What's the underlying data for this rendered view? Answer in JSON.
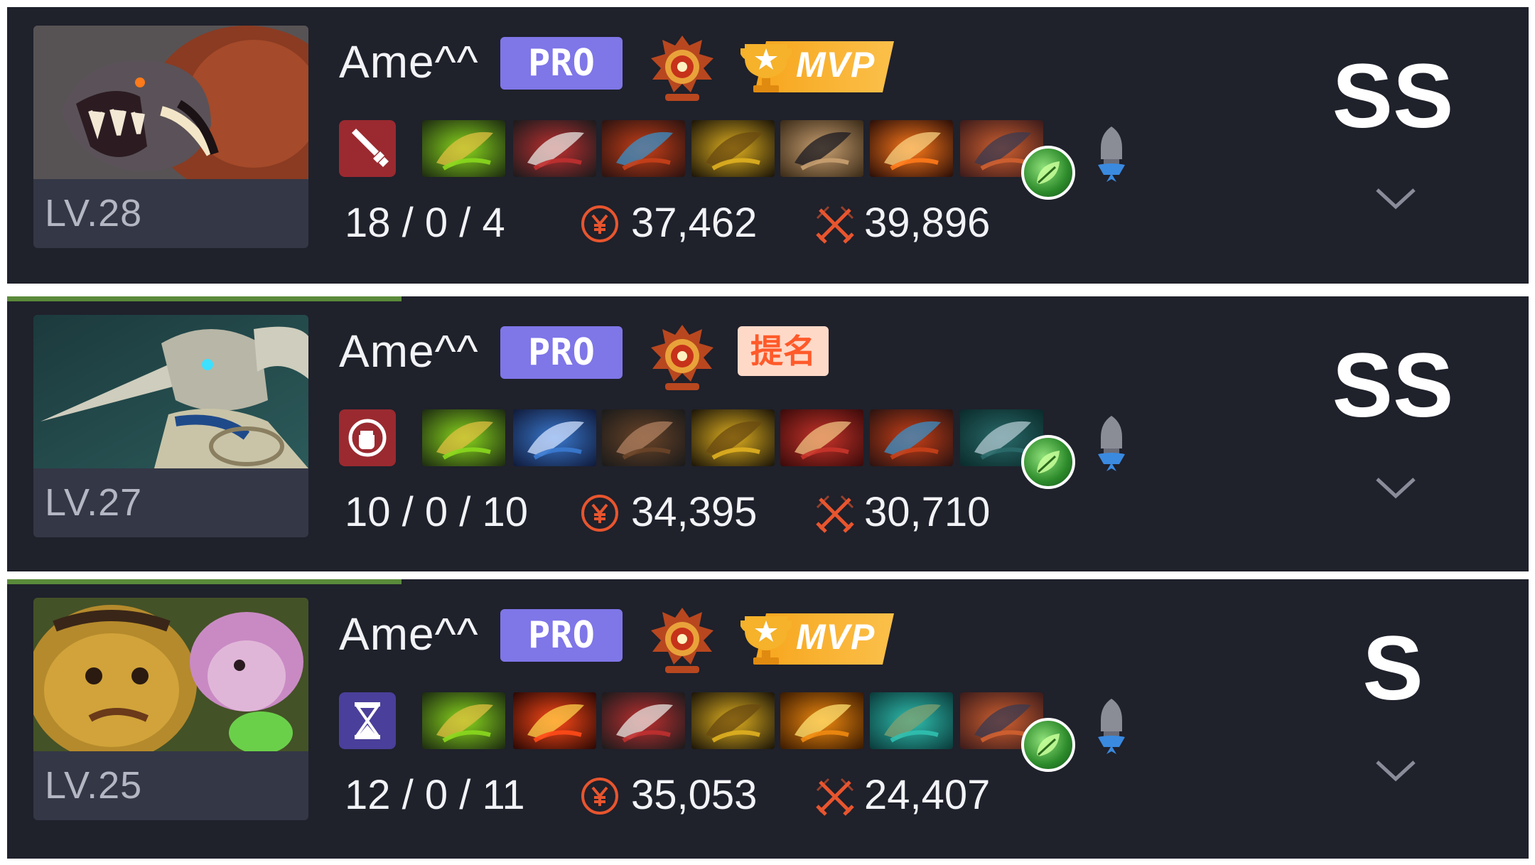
{
  "colors": {
    "card_bg": "#1f212b",
    "pro_badge": "#7f76e8",
    "mvp_gold": "#f7a51c",
    "nominated_bg": "#ffd9c8",
    "nominated_text": "#ff5a2a",
    "stat_icon": "#e8552e"
  },
  "matches": [
    {
      "hero_icon": "ursa-portrait",
      "level": "LV.28",
      "player": "Ame^^",
      "pro_label": "PRO",
      "rank_icon": "immortal-rank-icon",
      "award": "MVP",
      "award_kind": "mvp",
      "role_icon": "dagger-icon",
      "items": [
        "battle-fury-icon",
        "desolator-icon",
        "black-king-bar-icon",
        "basher-icon",
        "phase-boots-icon",
        "ice-axe-icon",
        "aegis-icon"
      ],
      "neutral_icon": "leaf-neutral-icon",
      "kda": "18 / 0 / 4",
      "gold": "37,462",
      "damage": "39,896",
      "grade": "SS"
    },
    {
      "hero_icon": "sven-portrait",
      "level": "LV.27",
      "player": "Ame^^",
      "pro_label": "PRO",
      "rank_icon": "immortal-rank-icon",
      "award": "提名",
      "award_kind": "nominated",
      "role_icon": "fist-icon",
      "items": [
        "battle-fury-icon",
        "trident-icon",
        "boots-icon",
        "basher-icon",
        "crossbow-icon",
        "black-king-bar-icon",
        "blade-icon"
      ],
      "neutral_icon": "leaf-neutral-icon",
      "kda": "10 / 0 / 10",
      "gold": "34,395",
      "damage": "30,710",
      "grade": "SS"
    },
    {
      "hero_icon": "alchemist-portrait",
      "level": "LV.25",
      "player": "Ame^^",
      "pro_label": "PRO",
      "rank_icon": "immortal-rank-icon",
      "award": "MVP",
      "award_kind": "mvp",
      "role_icon": "hourglass-icon",
      "items": [
        "battle-fury-icon",
        "radiance-icon",
        "desolator-icon",
        "basher-icon",
        "sword-icon",
        "armor-icon",
        "aegis-icon"
      ],
      "neutral_icon": "leaf-neutral-icon",
      "kda": "12 / 0 / 11",
      "gold": "35,053",
      "damage": "24,407",
      "grade": "S"
    }
  ]
}
